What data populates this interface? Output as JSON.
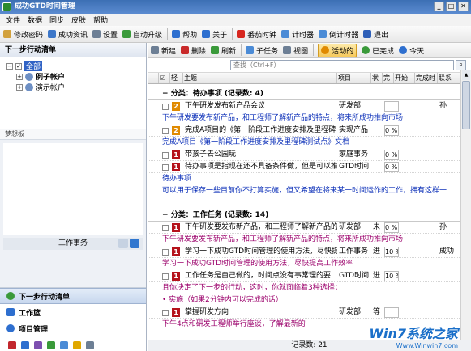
{
  "window": {
    "title": "成功GTD时间管理",
    "controls": [
      "_",
      "□",
      "✕"
    ]
  },
  "menu": [
    "文件",
    "数据",
    "同步",
    "皮肤",
    "帮助"
  ],
  "toolbar": [
    {
      "label": "修改密码",
      "icon": "key-icon",
      "color": "#d2a13c"
    },
    {
      "label": "成功资讯",
      "icon": "news-icon",
      "color": "#3d77c9"
    },
    {
      "label": "设置",
      "icon": "gear-icon",
      "color": "#6d7f95"
    },
    {
      "label": "自动升级",
      "icon": "upgrade-icon",
      "color": "#3a9a3a"
    },
    {
      "label": "帮助",
      "icon": "help-icon",
      "color": "#2e6fcf"
    },
    {
      "label": "关于",
      "icon": "info-icon",
      "color": "#2e6fcf"
    },
    {
      "label": "番茄时钟",
      "icon": "tomato-icon",
      "color": "#d7261e"
    },
    {
      "label": "计时器",
      "icon": "timer-icon",
      "color": "#4b8bd6"
    },
    {
      "label": "倒计时器",
      "icon": "countdown-icon",
      "color": "#4b8bd6"
    },
    {
      "label": "退出",
      "icon": "exit-icon",
      "color": "#2e5fb8"
    }
  ],
  "left": {
    "title": "下一步行动清单",
    "tree": {
      "root": "全部",
      "items": [
        "例子帐户",
        "演示帐户"
      ]
    },
    "memo_label": "梦想板",
    "memo_footer": "工作事务",
    "nav": [
      "下一步行动清单",
      "工作篮",
      "项目管理"
    ]
  },
  "right": {
    "actions": [
      {
        "label": "新建",
        "icon": "new-icon",
        "color": "#6d7f95"
      },
      {
        "label": "删除",
        "icon": "delete-icon",
        "color": "#c92a2a"
      },
      {
        "label": "刷新",
        "icon": "refresh-icon",
        "color": "#3a9a3a"
      },
      {
        "label": "子任务",
        "icon": "subtask-icon",
        "color": "#4b8bd6"
      },
      {
        "label": "视图",
        "icon": "view-icon",
        "color": "#6d7f95"
      },
      {
        "label": "活动的",
        "icon": "active-icon",
        "color": "#e08a00"
      },
      {
        "label": "已完成",
        "icon": "done-icon",
        "color": "#3a9a3a"
      },
      {
        "label": "今天",
        "icon": "today-icon",
        "color": "#2e6fcf"
      }
    ],
    "search_placeholder": "查找（Ctrl+F）",
    "columns": [
      "轻",
      "主题",
      "项目",
      "状",
      "完",
      "开始",
      "完成时",
      "联系"
    ],
    "groups": [
      {
        "title": "分类：待办事项 (记录数: 4)"
      },
      {
        "title": "分类：工作任务 (记录数: 14)"
      }
    ],
    "rows1": [
      {
        "n": "2",
        "topic": "下午研发发布新产品会议",
        "project": "研发部",
        "pct": "",
        "contact": "孙"
      },
      {
        "n": "",
        "topic": "下午研发要发布新产品，和工程师了解新产品的特点，将来所成功推向市场",
        "project": "",
        "pct": "",
        "contact": ""
      },
      {
        "n": "2",
        "topic": "完成A项目的《第一阶段工作进度安排及里程碑",
        "project": "实现产品",
        "pct": "0 %",
        "contact": ""
      },
      {
        "n": "",
        "topic": "完成A项目《第一阶段工作进度安排及里程碑测试点》文档",
        "project": "",
        "pct": "",
        "contact": ""
      },
      {
        "n": "1",
        "topic": "带孩子去公园玩",
        "project": "家庭事务",
        "pct": "0 %",
        "contact": ""
      },
      {
        "n": "1",
        "topic": "待办事项是指现在还不具备条件做，但是可以推",
        "project": "GTD时间",
        "pct": "0 %",
        "contact": ""
      },
      {
        "n": "",
        "topic": "待办事项",
        "project": "",
        "pct": "",
        "contact": ""
      },
      {
        "n": "",
        "topic": "可以用于保存一些目前你不打算实施，但又希望在将来某一时间运作的工作，拥有这样一",
        "project": "",
        "pct": "",
        "contact": ""
      }
    ],
    "rows2": [
      {
        "n": "1",
        "topic": "下午研发要发布新产品，和工程师了解新产品的",
        "project": "研发部",
        "status": "未",
        "pct": "0 %",
        "contact": "孙"
      },
      {
        "n": "",
        "topic": "下午研发要发布新产品，和工程师了解新产品的特点，将来所成功推向市场",
        "project": "",
        "status": "",
        "pct": "",
        "contact": ""
      },
      {
        "n": "1",
        "topic": "学习一下成功GTD时间管理的使用方法，尽快提",
        "project": "工作事务",
        "status": "进",
        "pct": "10 %",
        "contact": "成功"
      },
      {
        "n": "",
        "topic": "学习一下成功GTD时间管理的使用方法，尽快提高工作效率",
        "project": "",
        "status": "",
        "pct": "",
        "contact": ""
      },
      {
        "n": "1",
        "topic": "工作任务是自己做的，时间点没有事常理的要",
        "project": "GTD时间",
        "status": "进",
        "pct": "10 %",
        "contact": ""
      },
      {
        "n": "",
        "topic": "且你决定了下一步的行动，这时，你就面临着3种选择：",
        "project": "",
        "status": "",
        "pct": "",
        "contact": ""
      },
      {
        "n": "",
        "topic": "• 实施（如果2分钟内可以完成的话）",
        "project": "",
        "status": "",
        "pct": "",
        "contact": ""
      },
      {
        "n": "1",
        "topic": "掌握研发方向",
        "project": "研发部",
        "status": "等",
        "pct": "",
        "contact": ""
      },
      {
        "n": "",
        "topic": "下午4点和研发工程师举行座谈，了解最新的",
        "project": "",
        "status": "",
        "pct": "",
        "contact": ""
      }
    ],
    "status": "记录数: 21"
  },
  "watermark": {
    "brand": "Win7系统之家",
    "url": "Www.Winwin7.com"
  }
}
